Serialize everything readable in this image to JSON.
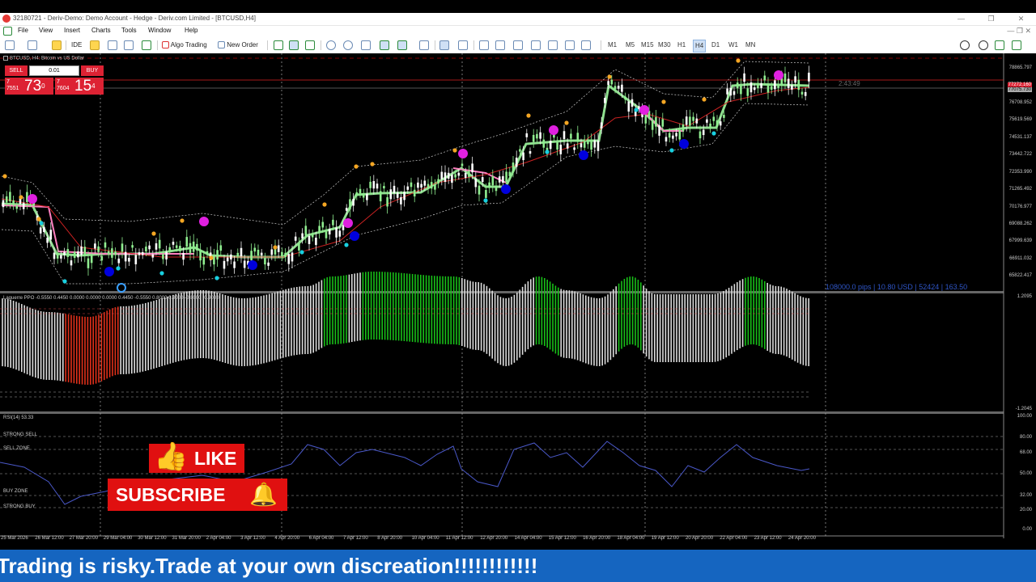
{
  "window": {
    "title": "32180721 - Deriv-Demo: Demo Account - Hedge - Deriv.com Limited - [BTCUSD,H4]",
    "controls": [
      "—",
      "❐",
      "✕"
    ]
  },
  "menu": [
    "File",
    "View",
    "Insert",
    "Charts",
    "Tools",
    "Window",
    "Help"
  ],
  "toolbar": {
    "ide_label": "IDE",
    "algo_label": "Algo Trading",
    "new_order_label": "New Order",
    "timeframes": [
      "M1",
      "M5",
      "M15",
      "M30",
      "H1",
      "H4",
      "D1",
      "W1",
      "MN"
    ],
    "active_timeframe": "H4"
  },
  "chart": {
    "symbol_label": "BTCUSD, H4:  Bitcoin vs US Dollar",
    "sell_label": "SELL",
    "buy_label": "BUY",
    "lot": "0.01",
    "sell_price": {
      "small": "7\n7551",
      "big": "73",
      "sup": "0"
    },
    "buy_price": {
      "small": "7\n7604",
      "big": "15",
      "sup": "4"
    },
    "countdown": "2:43:49",
    "info_line": "108000.0 pips | 10.80 USD | 52424 | 163.50",
    "price_axis": [
      "78865.797",
      "77786.180",
      "76708.952",
      "75619.569",
      "74531.137",
      "73442.722",
      "72353.990",
      "71265.492",
      "70176.977",
      "69088.262",
      "67999.639",
      "66911.032",
      "65822.417"
    ],
    "bid_label": "77272.160",
    "ask_label": "77075.730"
  },
  "laguerre": {
    "label": "Laguerre PPO -0.5550 0.4450 0.0000 0.0000 0.0000 0.4450 -0.5550 0.8000 0.9000 -0.8000 -0.9000",
    "top_value": "1.2095",
    "bottom_value": "-1.2045"
  },
  "rsi": {
    "label": "RSI(14) 53.33",
    "zones": [
      "STRONG SELL",
      "SELL ZONE",
      "BUY ZONE",
      "STRONG BUY"
    ],
    "axis": [
      "100.00",
      "80.00",
      "68.00",
      "50.00",
      "32.00",
      "20.00",
      "0.00"
    ]
  },
  "time_axis": [
    "25 Mar 2026",
    "26 Mar 12:00",
    "27 Mar 20:00",
    "29 Mar 04:00",
    "30 Mar 12:00",
    "31 Mar 20:00",
    "2 Apr 04:00",
    "3 Apr 12:00",
    "4 Apr 20:00",
    "6 Apr 04:00",
    "7 Apr 12:00",
    "8 Apr 20:00",
    "10 Apr 04:00",
    "11 Apr 12:00",
    "12 Apr 20:00",
    "14 Apr 04:00",
    "15 Apr 12:00",
    "16 Apr 20:00",
    "18 Apr 04:00",
    "19 Apr 12:00",
    "20 Apr 20:00",
    "22 Apr 04:00",
    "23 Apr 12:00",
    "24 Apr 20:00"
  ],
  "overlay": {
    "like": "LIKE",
    "subscribe": "SUBSCRIBE",
    "footer": "Trading is risky.Trade at your own discreation!!!!!!!!!!!!"
  },
  "colors": {
    "up_candle": "#90ee90",
    "sma_green": "#8fe08f",
    "sma_pink": "#ff7fbf",
    "rsi_line": "#4a58c8",
    "footer_bg": "#1565c0",
    "overlay_red": "#e01010"
  }
}
